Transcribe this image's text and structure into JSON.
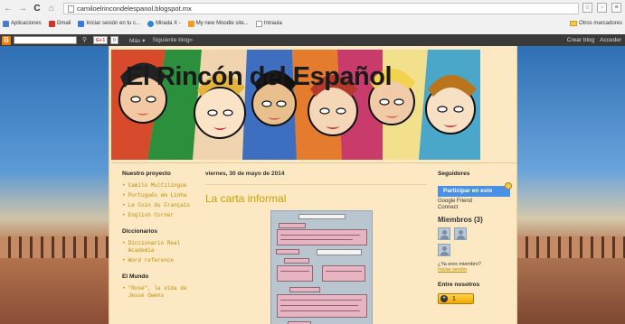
{
  "browser": {
    "nav_back": "←",
    "nav_forward": "→",
    "reload": "C",
    "home": "⌂",
    "url": "camiloelrincondelespanol.blogspot.mx",
    "bookmarks": [
      {
        "label": "Aplicaciones",
        "icon_color": "#4a7dd1"
      },
      {
        "label": "Gmail",
        "icon_color": "#d93025"
      },
      {
        "label": "Iniciar sesión en tu c...",
        "icon_color": "#3b78e7"
      },
      {
        "label": "Mirada X -",
        "icon_color": "#2a88c9"
      },
      {
        "label": "My new Moodle site...",
        "icon_color": "#f29c20"
      },
      {
        "label": "Intraula",
        "icon_color": "#999999"
      }
    ],
    "other_bookmarks": "Otros marcadores"
  },
  "blogger_bar": {
    "logo": "B",
    "gplus": "G+1",
    "count": "0",
    "more": "Más ▾",
    "next_blog": "Siguiente blog»",
    "create_blog": "Crear blog",
    "access": "Acceder"
  },
  "blog": {
    "title": "El Rincón del Español"
  },
  "sidebar_left": {
    "project_title": "Nuestro proyecto",
    "project_links": [
      "Camilo Multilingue",
      "Português em Linha",
      "Le Coin du Français",
      "English Corner"
    ],
    "dict_title": "Diccionarios",
    "dict_links": [
      "Diccionario Real Academia",
      "Word reference"
    ],
    "world_title": "El Mundo",
    "world_links": [
      "\"Rose\", la vida de Jesse Owens"
    ]
  },
  "post": {
    "date": "viernes, 30 de mayo de 2014",
    "title": "La carta informal"
  },
  "sidebar_right": {
    "followers_title": "Seguidores",
    "follow_button": "Participar en este",
    "gfc_line1": "Google Friend",
    "gfc_line2": "Connect",
    "members": "Miembros (3)",
    "already_member": "¿Ya eres miembro?",
    "sign_in": "Iniciar sesión",
    "entre_title": "Entre nosotros",
    "counter_value": "1"
  }
}
